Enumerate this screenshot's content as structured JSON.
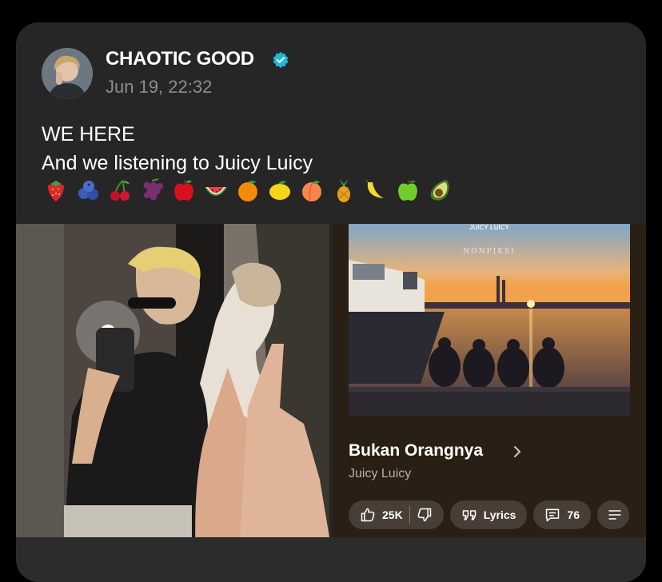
{
  "author": {
    "name": "CHAOTIC GOOD",
    "verified": true,
    "timestamp": "Jun 19, 22:32"
  },
  "post": {
    "lines": [
      "WE HERE",
      "And we listening to Juicy Luicy"
    ],
    "emojis": [
      "strawberry",
      "blueberries",
      "cherries",
      "grapes",
      "red-apple",
      "watermelon",
      "tangerine",
      "lemon",
      "peach",
      "pineapple",
      "banana",
      "green-apple",
      "avocado"
    ]
  },
  "music": {
    "cover_brand": "NONFIKSI",
    "cover_logo": "JUICY LUICY",
    "title": "Bukan Orangnya",
    "artist": "Juicy Luicy",
    "likes": "25K",
    "lyrics_label": "Lyrics",
    "comments": "76"
  },
  "colors": {
    "card_bg": "#262626",
    "verified": "#1da1f2",
    "timestamp": "#8d8d8d",
    "music_bg": "#2a1f14"
  }
}
